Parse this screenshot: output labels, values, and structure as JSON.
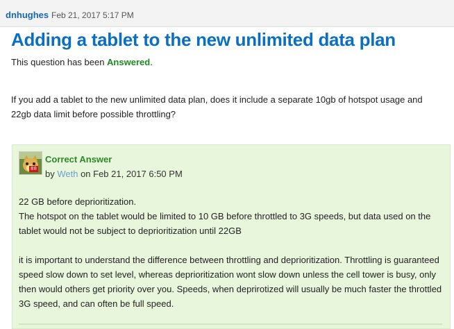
{
  "header": {
    "author": "dnhughes",
    "posted_date": "Feb 21, 2017 5:17 PM"
  },
  "question": {
    "title": "Adding a tablet to the new unlimited data plan",
    "status_prefix": "This question has been ",
    "status_word": "Answered",
    "status_suffix": ".",
    "body": "If you add a tablet to the new unlimited data plan, does it include a separate 10gb of hotspot usage and 22gb data limit before possible throttling?"
  },
  "answer": {
    "label": "Correct Answer",
    "by_prefix": "by ",
    "user": "Weth",
    "date_text": " on Feb 21, 2017 6:50 PM",
    "badge": "88",
    "paragraph_1_line_1": "22 GB before deprioritization.",
    "paragraph_1_line_2": "The hotspot on the tablet would be limited to 10 GB before throttled to 3G speeds, but data used on the tablet would not be subject to deprioritization until 22GB",
    "paragraph_2": "it is important to understand the difference between throttling and deprioritization.  Throttling is guaranteed speed slow down to set level, whereas deprioritization wont slow down unless the cell tower is busy, only then would others get priority over you.  Speeds, when deprirotized will usually be much faster the throttled 3G speed, and can often be full speed."
  },
  "colors": {
    "title": "#0a6fc2",
    "answered": "#1d8a1d",
    "answer_background": "#e8f6dc",
    "author_link": "#1866b4"
  },
  "icons": {
    "avatar": "cat-avatar-icon"
  }
}
